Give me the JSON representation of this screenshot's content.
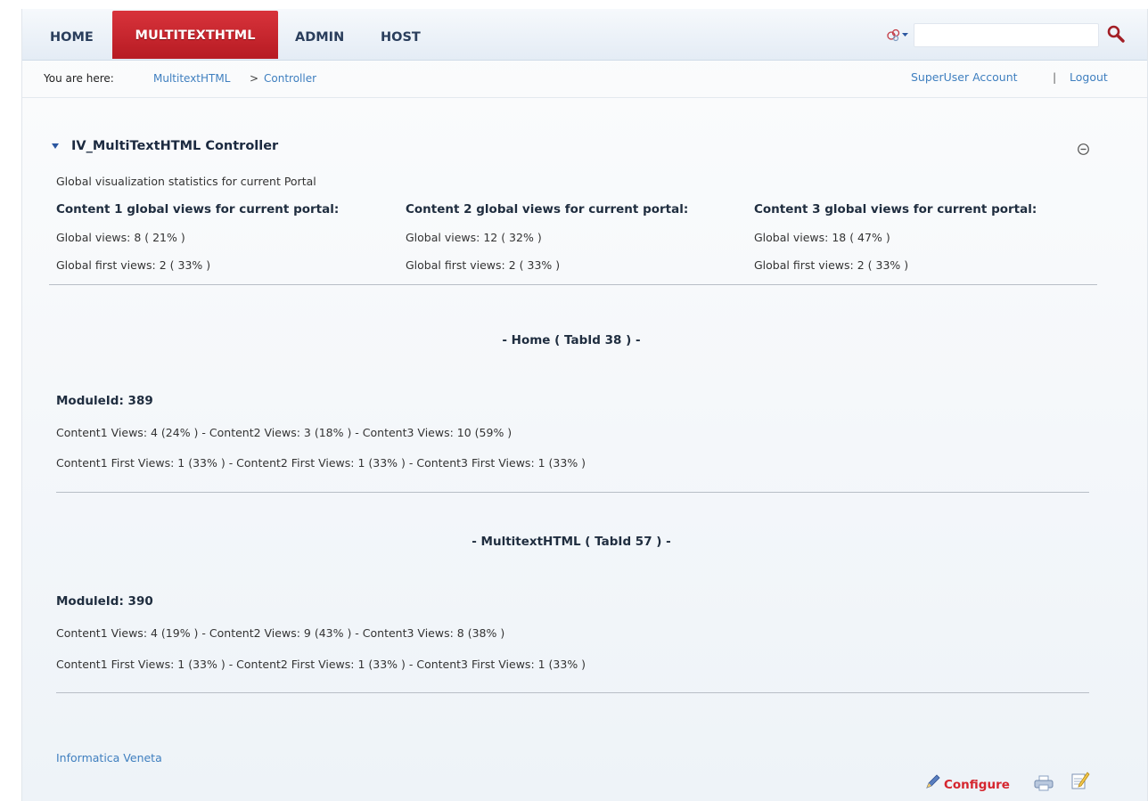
{
  "nav": {
    "items": [
      {
        "label": "HOME"
      },
      {
        "label": "MULTITEXTHTML"
      },
      {
        "label": "ADMIN"
      },
      {
        "label": "HOST"
      }
    ],
    "search_value": ""
  },
  "breadcrumb": {
    "prefix": "You are here:",
    "items": [
      "MultitextHTML",
      "Controller"
    ],
    "separator": ">"
  },
  "user": {
    "account": "SuperUser Account",
    "separator": "|",
    "logout": "Logout"
  },
  "module": {
    "title": "IV_MultiTextHTML Controller",
    "subtitle": "Global visualization statistics for current Portal",
    "columns": [
      {
        "heading": "Content 1 global views for current portal:",
        "views": "Global views: 8 ( 21% )",
        "first_views": "Global first views: 2 ( 33% )"
      },
      {
        "heading": "Content 2 global views for current portal:",
        "views": "Global views: 12 ( 32% )",
        "first_views": "Global first views: 2 ( 33% )"
      },
      {
        "heading": "Content 3 global views for current portal:",
        "views": "Global views: 18 ( 47% )",
        "first_views": "Global first views: 2 ( 33% )"
      }
    ],
    "tabs": [
      {
        "heading": "- Home ( TabId 38 ) -",
        "module_id": "ModuleId: 389",
        "views": "Content1 Views: 4 (24% ) - Content2 Views: 3 (18% ) - Content3 Views: 10 (59% )",
        "first_views": "Content1 First Views: 1 (33% ) - Content2 First Views: 1 (33% ) - Content3 First Views: 1 (33% )"
      },
      {
        "heading": "- MultitextHTML ( TabId 57 ) -",
        "module_id": "ModuleId: 390",
        "views": "Content1 Views: 4 (19% ) - Content2 Views: 9 (43% ) - Content3 Views: 8 (38% )",
        "first_views": "Content1 First Views: 1 (33% ) - Content2 First Views: 1 (33% ) - Content3 First Views: 1 (33% )"
      }
    ]
  },
  "footer": {
    "link": "Informatica Veneta",
    "configure": "Configure"
  },
  "colors": {
    "accent_red": "#c4222a",
    "link_blue": "#3f7fbf"
  }
}
